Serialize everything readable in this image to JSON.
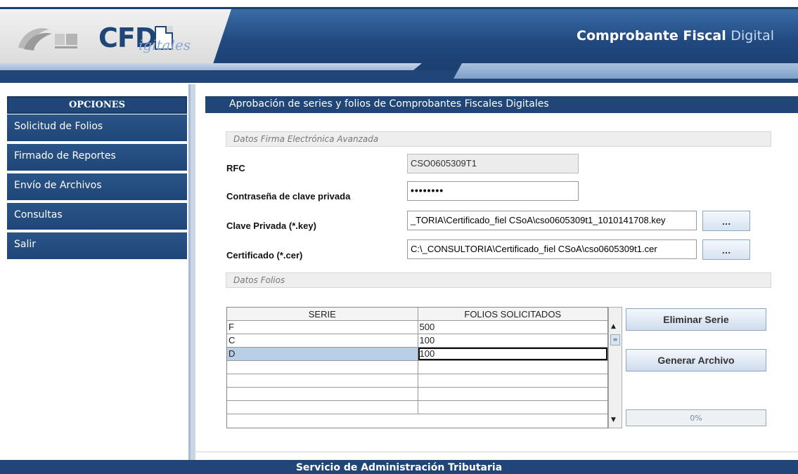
{
  "header": {
    "logo_text": "CFD",
    "logo_sub": "igitales",
    "app_title_main": "Comprobante Fiscal",
    "app_title_accent": "Digital"
  },
  "sidebar": {
    "heading": "OPCIONES",
    "items": [
      {
        "label": "Solicitud de Folios"
      },
      {
        "label": "Firmado de Reportes"
      },
      {
        "label": "Envío de Archivos"
      },
      {
        "label": "Consultas"
      },
      {
        "label": "Salir"
      }
    ]
  },
  "main": {
    "title": "Aprobación de series y folios de Comprobantes Fiscales Digitales",
    "section_firma": "Datos Firma Electrónica Avanzada",
    "rfc_label": "RFC",
    "rfc_value": "CSO0605309T1",
    "password_label": "Contraseña de clave privada",
    "password_value": "••••••••",
    "key_label": "Clave Privada (*.key)",
    "key_value": "_TORIA\\Certificado_fiel CSoA\\cso0605309t1_1010141708.key",
    "cer_label": "Certificado (*.cer)",
    "cer_value": "C:\\_CONSULTORIA\\Certificado_fiel CSoA\\cso0605309t1.cer",
    "browse_label": "...",
    "section_folios": "Datos Folios"
  },
  "table": {
    "columns": [
      "SERIE",
      "FOLIOS SOLICITADOS"
    ],
    "rows": [
      {
        "serie": "F",
        "folios": "500"
      },
      {
        "serie": "C",
        "folios": "100"
      },
      {
        "serie": "D",
        "folios": "100"
      },
      {
        "serie": "",
        "folios": ""
      },
      {
        "serie": "",
        "folios": ""
      },
      {
        "serie": "",
        "folios": ""
      },
      {
        "serie": "",
        "folios": ""
      }
    ],
    "selected_row": 2
  },
  "actions": {
    "delete_label": "Eliminar Serie",
    "generate_label": "Generar Archivo",
    "progress_text": "0%",
    "progress_value": 0
  },
  "footer": {
    "text": "Servicio de Administración Tributaria"
  },
  "colors": {
    "primary": "#1f4677",
    "header_gradient_top": "#3d6eaa",
    "selected_row": "#b8cfe6"
  }
}
